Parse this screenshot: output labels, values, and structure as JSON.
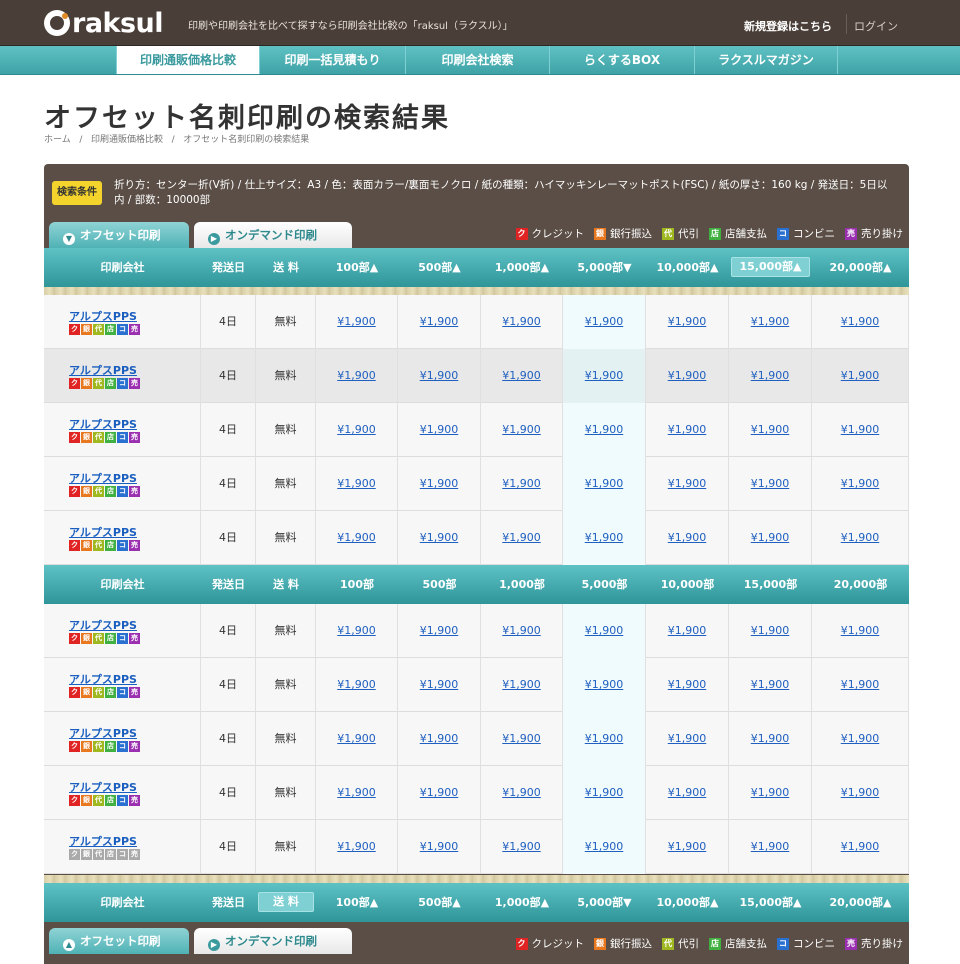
{
  "header": {
    "logo": "raksul",
    "tagline": "印刷や印刷会社を比べて探すなら印刷会社比較の「raksul（ラクスル）」",
    "signup": "新規登録はこちら",
    "login": "ログイン"
  },
  "nav": [
    {
      "label": "印刷通販価格比較"
    },
    {
      "label": "印刷一括見積もり"
    },
    {
      "label": "印刷会社検索"
    },
    {
      "label": "らくするBOX"
    },
    {
      "label": "ラクスルマガジン"
    }
  ],
  "page": {
    "title": "オフセット名刺印刷の検索結果",
    "breadcrumb": [
      "ホーム",
      "印刷通販価格比較",
      "オフセット名刺印刷の検索結果"
    ]
  },
  "conditions": {
    "badge": "検索条件",
    "text": "折り方：センター折(V折) / 仕上サイズ：A3 / 色：表面カラー/裏面モノクロ / 紙の種類：ハイマッキンレーマットポスト(FSC) / 紙の厚さ：160 kg / 発送日：5日以内 / 部数：10000部"
  },
  "tabs": {
    "offset": "オフセット印刷",
    "ondemand": "オンデマンド印刷"
  },
  "legend": [
    {
      "icon": "ク",
      "label": "クレジット",
      "color": "#e02424"
    },
    {
      "icon": "銀",
      "label": "銀行振込",
      "color": "#e87820"
    },
    {
      "icon": "代",
      "label": "代引",
      "color": "#a0b820"
    },
    {
      "icon": "店",
      "label": "店舗支払",
      "color": "#40b040"
    },
    {
      "icon": "コ",
      "label": "コンビニ",
      "color": "#2a70d0"
    },
    {
      "icon": "売",
      "label": "売り掛け",
      "color": "#9a30b0"
    }
  ],
  "columns": {
    "company": "印刷会社",
    "ship": "発送日",
    "fee": "送 料",
    "q": [
      "100部",
      "500部",
      "1,000部",
      "5,000部",
      "10,000部",
      "15,000部",
      "20,000部"
    ]
  },
  "rows": [
    {
      "company": "アルプスPPS",
      "ship": "4日",
      "fee": "無料",
      "prices": [
        "¥1,900",
        "¥1,900",
        "¥1,900",
        "¥1,900",
        "¥1,900",
        "¥1,900",
        "¥1,900"
      ]
    },
    {
      "company": "アルプスPPS",
      "ship": "4日",
      "fee": "無料",
      "prices": [
        "¥1,900",
        "¥1,900",
        "¥1,900",
        "¥1,900",
        "¥1,900",
        "¥1,900",
        "¥1,900"
      ]
    },
    {
      "company": "アルプスPPS",
      "ship": "4日",
      "fee": "無料",
      "prices": [
        "¥1,900",
        "¥1,900",
        "¥1,900",
        "¥1,900",
        "¥1,900",
        "¥1,900",
        "¥1,900"
      ]
    },
    {
      "company": "アルプスPPS",
      "ship": "4日",
      "fee": "無料",
      "prices": [
        "¥1,900",
        "¥1,900",
        "¥1,900",
        "¥1,900",
        "¥1,900",
        "¥1,900",
        "¥1,900"
      ]
    },
    {
      "company": "アルプスPPS",
      "ship": "4日",
      "fee": "無料",
      "prices": [
        "¥1,900",
        "¥1,900",
        "¥1,900",
        "¥1,900",
        "¥1,900",
        "¥1,900",
        "¥1,900"
      ]
    },
    {
      "company": "アルプスPPS",
      "ship": "4日",
      "fee": "無料",
      "prices": [
        "¥1,900",
        "¥1,900",
        "¥1,900",
        "¥1,900",
        "¥1,900",
        "¥1,900",
        "¥1,900"
      ]
    },
    {
      "company": "アルプスPPS",
      "ship": "4日",
      "fee": "無料",
      "prices": [
        "¥1,900",
        "¥1,900",
        "¥1,900",
        "¥1,900",
        "¥1,900",
        "¥1,900",
        "¥1,900"
      ]
    },
    {
      "company": "アルプスPPS",
      "ship": "4日",
      "fee": "無料",
      "prices": [
        "¥1,900",
        "¥1,900",
        "¥1,900",
        "¥1,900",
        "¥1,900",
        "¥1,900",
        "¥1,900"
      ]
    },
    {
      "company": "アルプスPPS",
      "ship": "4日",
      "fee": "無料",
      "prices": [
        "¥1,900",
        "¥1,900",
        "¥1,900",
        "¥1,900",
        "¥1,900",
        "¥1,900",
        "¥1,900"
      ]
    },
    {
      "company": "アルプスPPS",
      "ship": "4日",
      "fee": "無料",
      "prices": [
        "¥1,900",
        "¥1,900",
        "¥1,900",
        "¥1,900",
        "¥1,900",
        "¥1,900",
        "¥1,900"
      ],
      "gray": true
    }
  ]
}
